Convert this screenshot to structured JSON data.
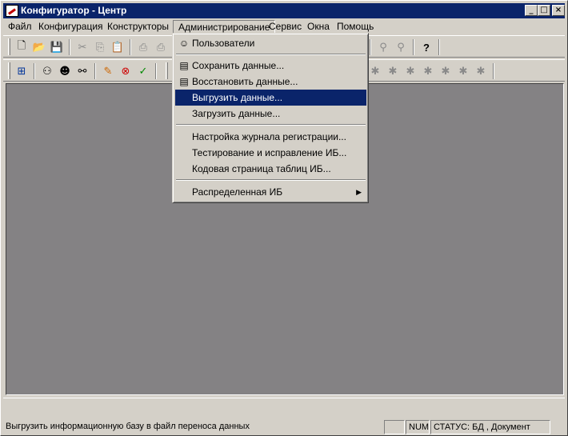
{
  "window": {
    "title": "Конфигуратор - Центр",
    "minimize": "_",
    "maximize": "□",
    "close": "×"
  },
  "menu": [
    {
      "label": "Файл"
    },
    {
      "label": "Конфигурация"
    },
    {
      "label": "Конструкторы"
    },
    {
      "label": "Администрирование"
    },
    {
      "label": "Сервис"
    },
    {
      "label": "Окна"
    },
    {
      "label": "Помощь"
    }
  ],
  "dropdown": {
    "items": [
      {
        "label": "Пользователи",
        "icon": "users-icon"
      },
      {
        "label": "Сохранить данные...",
        "icon": "save-data-icon"
      },
      {
        "label": "Восстановить данные...",
        "icon": "restore-data-icon"
      },
      {
        "label": "Выгрузить данные...",
        "highlighted": true
      },
      {
        "label": "Загрузить данные..."
      },
      {
        "label": "Настройка журнала регистрации..."
      },
      {
        "label": "Тестирование и исправление ИБ..."
      },
      {
        "label": "Кодовая страница таблиц ИБ..."
      },
      {
        "label": "Распределенная ИБ",
        "submenu": true,
        "arrow": "▶"
      }
    ]
  },
  "toolbar": {
    "row1_icons": [
      "new-icon",
      "open-icon",
      "save-icon",
      "cut-icon",
      "copy-icon",
      "paste-icon",
      "print-icon",
      "print-preview-icon",
      "find-icon",
      "help-icon"
    ],
    "help_glyph": "?",
    "row2_icons": [
      "tree-icon",
      "binoculars-icon",
      "user-icon",
      "search-icon",
      "edit-icon",
      "stop-icon",
      "check-icon"
    ]
  },
  "status": {
    "message": "Выгрузить информационную базу в файл переноса данных",
    "num": "NUM",
    "state": "СТАТУС: БД , Документ"
  },
  "colors": {
    "titlebar": "#0a246a",
    "highlight": "#0a246a",
    "face": "#d4d0c8",
    "mdi_background": "#848284"
  }
}
